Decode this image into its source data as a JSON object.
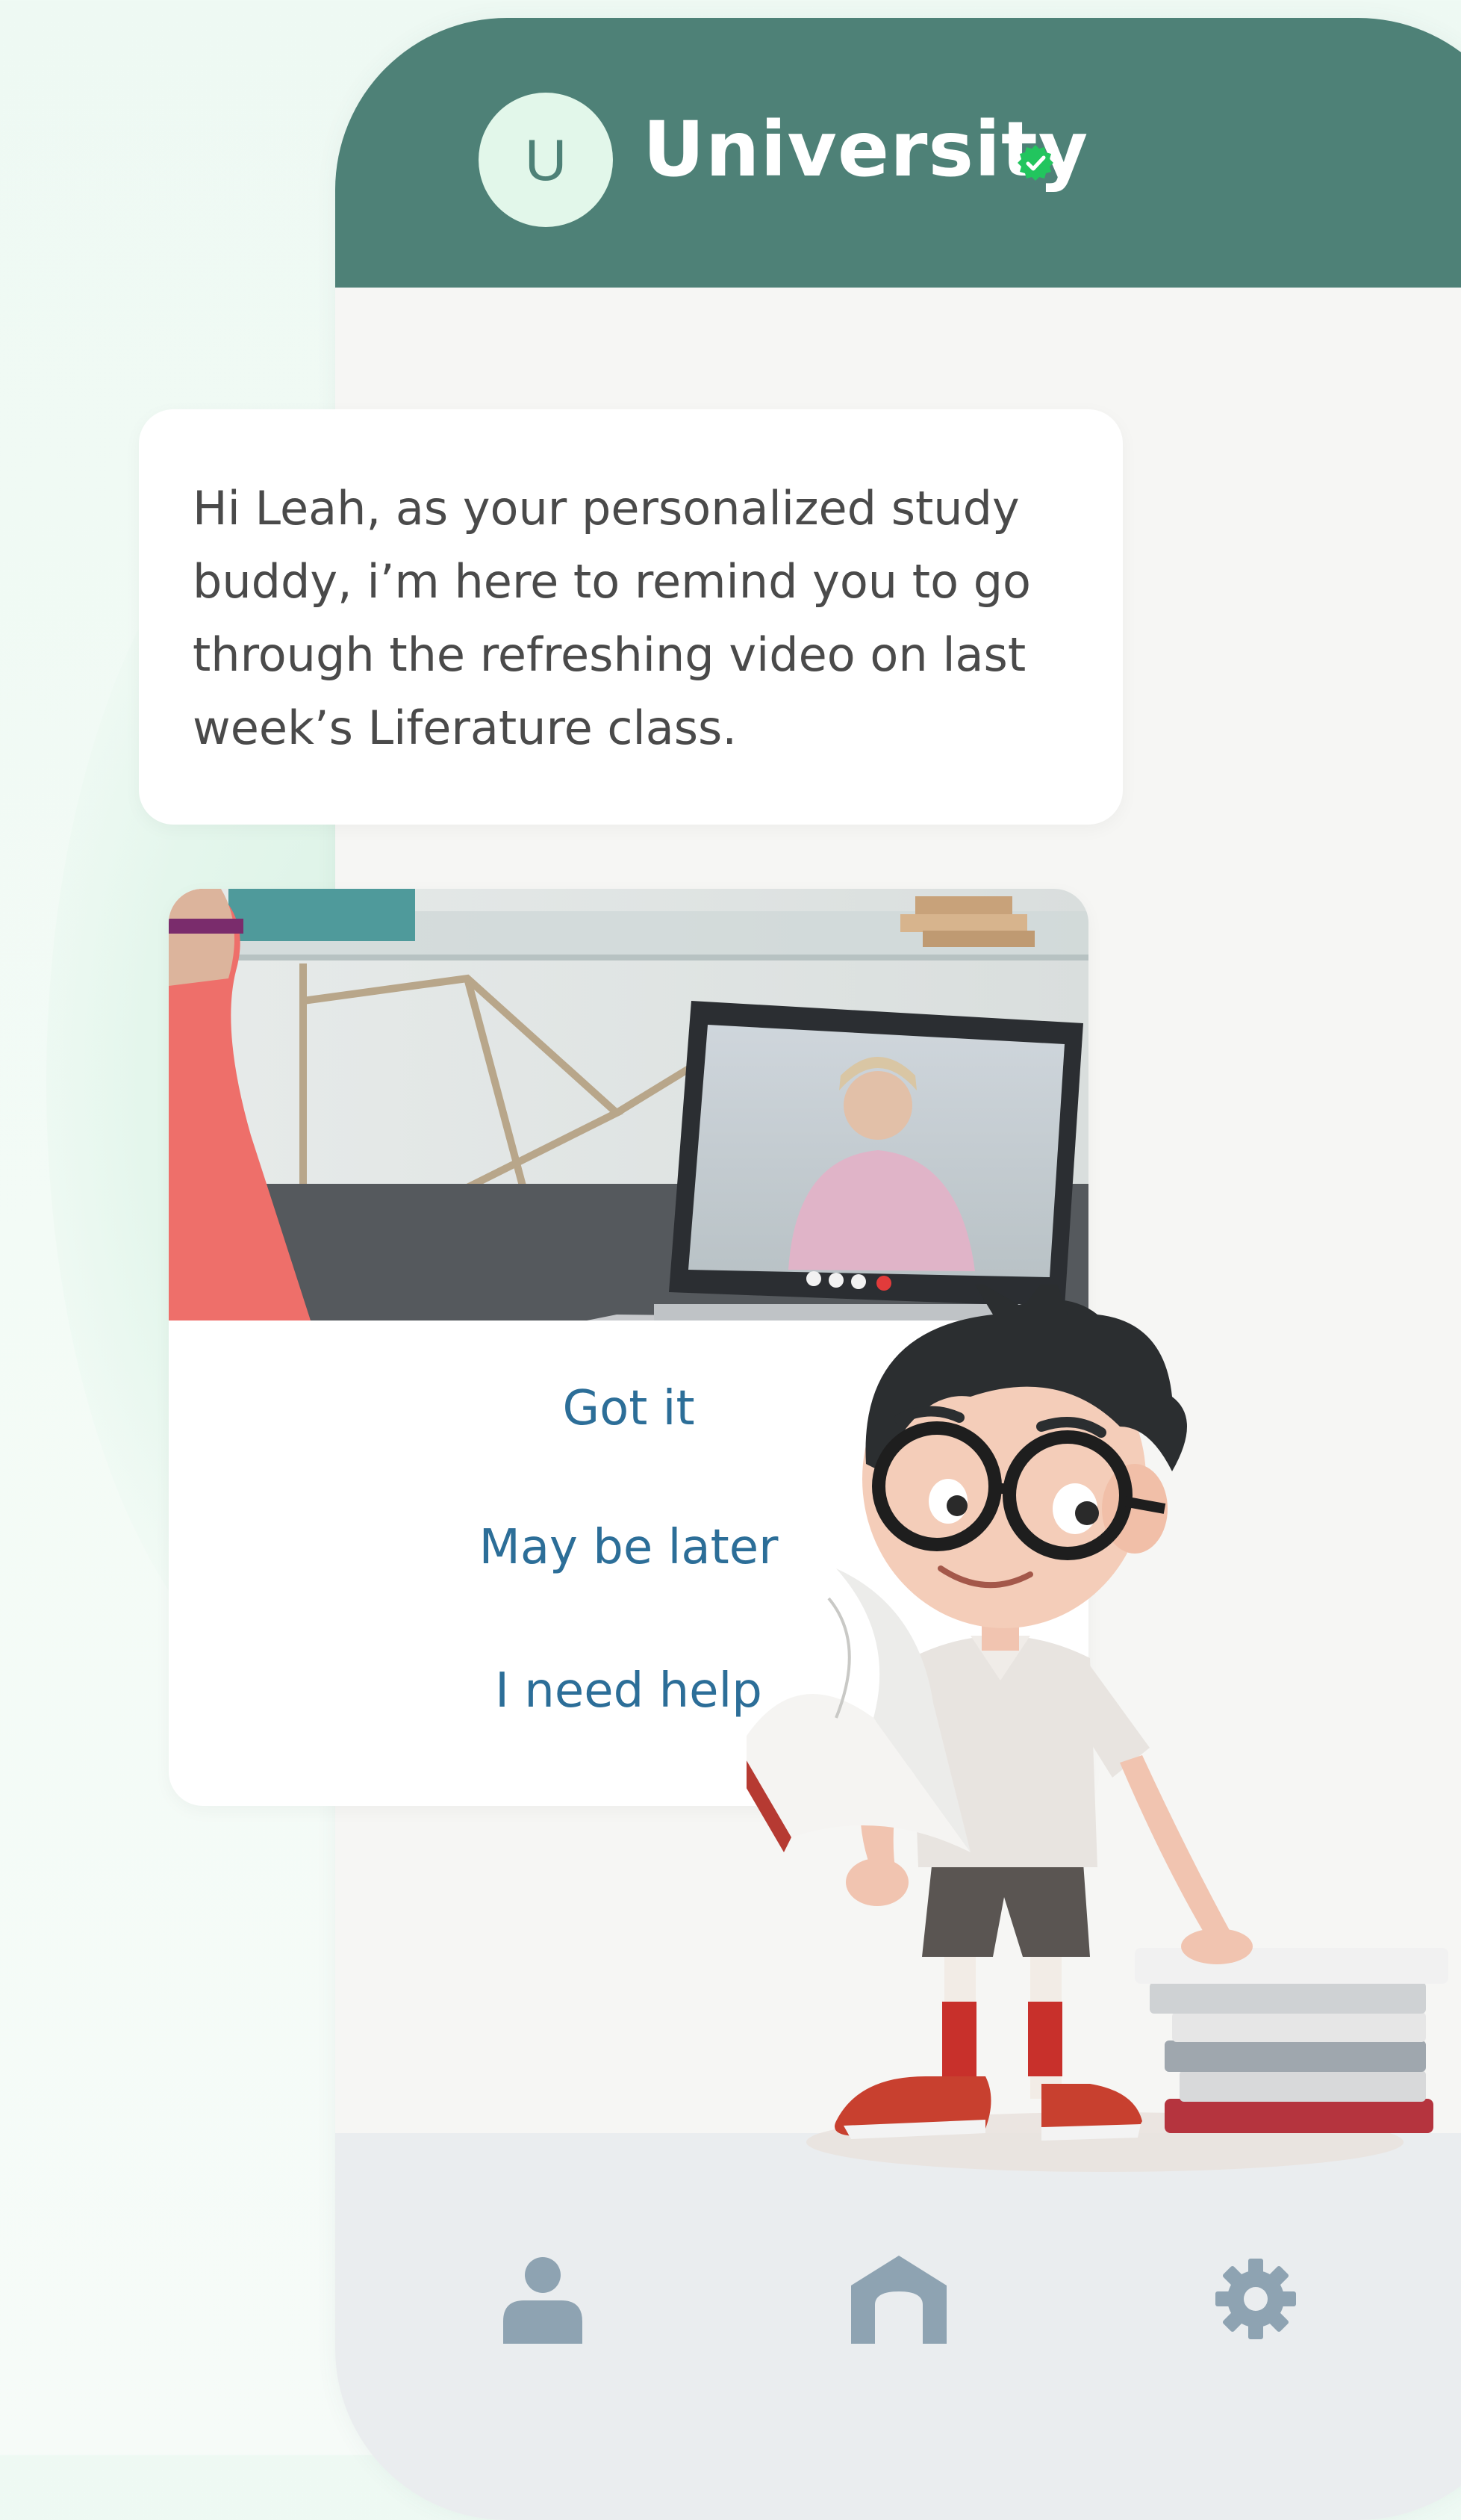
{
  "header": {
    "avatar_letter": "U",
    "title": "University",
    "verified_icon": "check-badge-icon"
  },
  "message": {
    "text": "Hi Leah, as your personalized study buddy, i’m here to remind you to go through the refreshing video on last week’s Liferature class."
  },
  "actions": {
    "got_it": "Got it",
    "maybe_later": "May be later",
    "need_help": "I need help"
  },
  "nav": {
    "items": [
      {
        "icon": "person-icon"
      },
      {
        "icon": "home-icon"
      },
      {
        "icon": "gear-icon"
      }
    ]
  },
  "colors": {
    "header": "#4e8177",
    "action_text": "#2c6e98",
    "nav_icon": "#8ea3b2",
    "verified": "#22c55e"
  }
}
